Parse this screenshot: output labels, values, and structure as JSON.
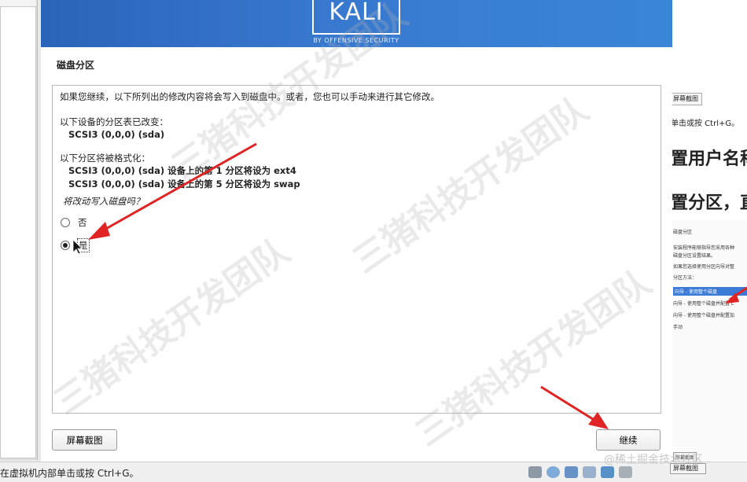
{
  "brand": {
    "logo_text": "KALI",
    "logo_subtitle": "BY OFFENSIVE SECURITY",
    "banner_color": "#3274c8"
  },
  "page": {
    "title": "磁盘分区",
    "intro": "如果您继续，以下所列出的修改内容将会写入到磁盘中。或者，您也可以手动来进行其它修改。",
    "table_changed_label": "以下设备的分区表已改变：",
    "table_changed_device": "SCSI3 (0,0,0) (sda)",
    "format_label": "以下分区将被格式化：",
    "format_items": [
      "SCSI3 (0,0,0) (sda) 设备上的第 1 分区将设为 ext4",
      "SCSI3 (0,0,0) (sda) 设备上的第 5 分区将设为 swap"
    ],
    "question": "将改动写入磁盘吗？",
    "options": [
      {
        "label": "否",
        "selected": false
      },
      {
        "label": "是",
        "selected": true
      }
    ]
  },
  "buttons": {
    "screenshot": "屏幕截图",
    "continue": "继续"
  },
  "host_right": {
    "button": "屏幕截图",
    "hint": "单击或按 Ctrl+G。",
    "heading1": "置用户名称",
    "heading2": "置分区，直",
    "mini_lines": [
      "磁盘分区",
      "安装程序能够指导您采用各种",
      "磁盘分区设置结果。",
      "如果您选择使用分区向导对整",
      "分区方法：",
      "向导 - 使用整个磁盘",
      "向导 - 使用整个磁盘并配置 L",
      "向导 - 使用整个磁盘并配置加",
      "手动"
    ],
    "mini_button": "屏幕截图"
  },
  "status_bar": {
    "text": "在虚拟机内部单击或按 Ctrl+G。",
    "right_watermark": "@稀土掘金技术社区"
  },
  "watermark": "三猪科技开发团队"
}
